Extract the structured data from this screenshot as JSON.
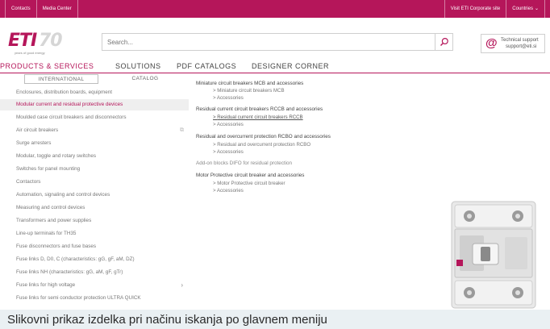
{
  "colors": {
    "brand": "#b5165a",
    "caption_bg": "#eaf0f3"
  },
  "topbar": {
    "left_links": [
      "Contacts",
      "Media Center"
    ],
    "right_links": [
      "Visit ETI Corporate site",
      "Countries"
    ]
  },
  "logo": {
    "text": "ETI",
    "anniversary": "70",
    "tagline": "years of good energy"
  },
  "search": {
    "placeholder": "Search...",
    "icon": "search-icon"
  },
  "support": {
    "icon": "at-icon",
    "line1": "Technical support",
    "line2": "support@eti.si"
  },
  "nav": {
    "items": [
      "PRODUCTS & SERVICES",
      "SOLUTIONS",
      "PDF CATALOGS",
      "DESIGNER CORNER"
    ],
    "active": "PRODUCTS & SERVICES"
  },
  "subtabs": {
    "active": "INTERNATIONAL",
    "other": "CATALOG"
  },
  "categories": [
    "Enclosures, distribution boards, equipment",
    "Modular current and residual protective devices",
    "Moulded case circuit breakers and disconnectors",
    "Air circuit breakers",
    "Surge arresters",
    "Modular, toggle and rotary switches",
    "Switches for panel mounting",
    "Contactors",
    "Automation, signaling and control devices",
    "Measuring and control devices",
    "Transformers and power supplies",
    "Line-up terminals for TH35",
    "Fuse disconnectors and fuse bases",
    "Fuse links D, D0, C (characteristics: gG, gF, aM, DZ)",
    "Fuse links NH (characteristics: gG, aM, gF, gTr)",
    "Fuse links for high voltage",
    "Fuse links for semi conductor protection ULTRA QUICK"
  ],
  "selected_category": "Modular current and residual protective devices",
  "sections": [
    {
      "title": "Miniature circuit breakers MCB and accessories",
      "items": [
        "Miniature circuit breakers MCB",
        "Accessories"
      ]
    },
    {
      "title": "Residual current circuit breakers RCCB and accessories",
      "items": [
        "Residual current circuit breakers RCCB",
        "Accessories"
      ]
    },
    {
      "title": "Residual and overcurrent protection RCBO and accessories",
      "items": [
        "Residual and overcurrent protection RCBO",
        "Accessories"
      ]
    },
    {
      "title": "Add-on blocks DIFO for residual protection",
      "items": []
    },
    {
      "title": "Motor Protective circuit breaker and accessories",
      "items": [
        "Motor Protective circuit breaker",
        "Accessories"
      ]
    }
  ],
  "caption": "Slikovni prikaz izdelka pri načinu iskanja po glavnem meniju"
}
